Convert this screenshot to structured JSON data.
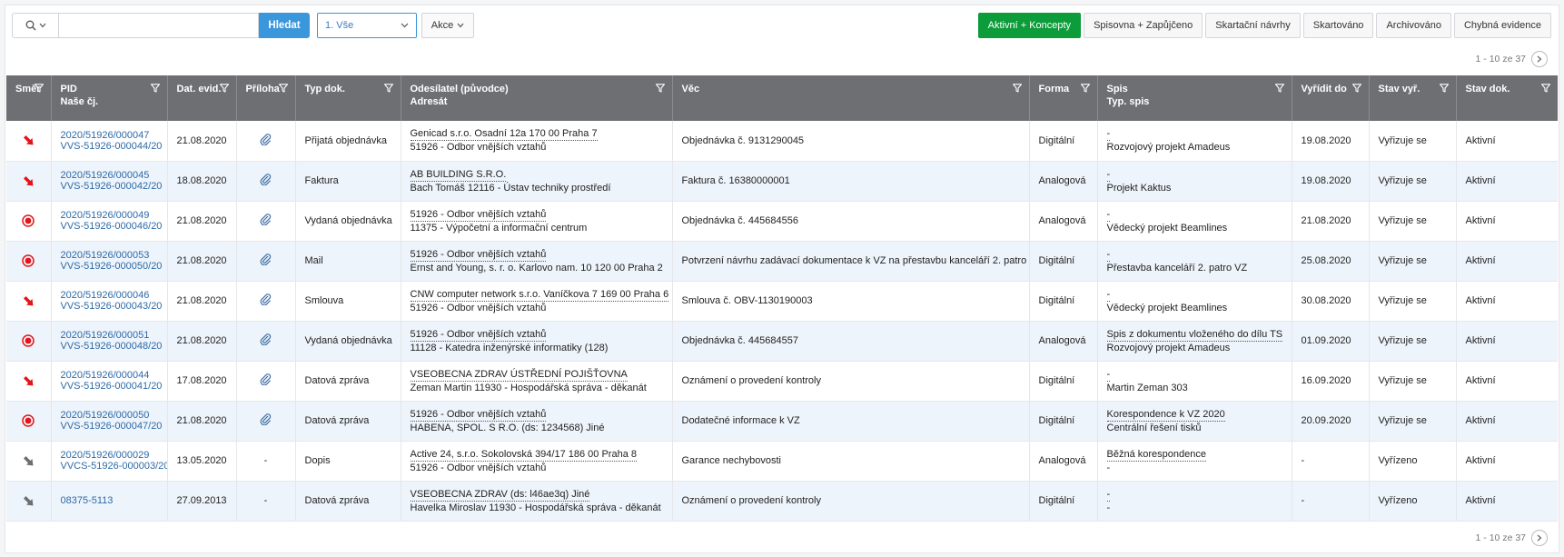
{
  "toolbar": {
    "search_placeholder": "",
    "search_button": "Hledat",
    "filter_select": "1. Vše",
    "actions_button": "Akce",
    "tabs": [
      "Aktivní + Koncepty",
      "Spisovna + Zapůjčeno",
      "Skartační návrhy",
      "Skartováno",
      "Archivováno",
      "Chybná evidence"
    ],
    "active_tab": "Aktivní + Koncepty"
  },
  "pager": {
    "top": "1 - 10 ze 37",
    "bottom": "1 - 10 ze 37"
  },
  "columns": [
    {
      "l1": "Směr",
      "l2": ""
    },
    {
      "l1": "PID",
      "l2": "Naše čj."
    },
    {
      "l1": "Dat. evid.",
      "l2": ""
    },
    {
      "l1": "Příloha",
      "l2": ""
    },
    {
      "l1": "Typ dok.",
      "l2": ""
    },
    {
      "l1": "Odesílatel (původce)",
      "l2": "Adresát"
    },
    {
      "l1": "Věc",
      "l2": ""
    },
    {
      "l1": "Forma",
      "l2": ""
    },
    {
      "l1": "Spis",
      "l2": "Typ. spis"
    },
    {
      "l1": "Vyřídit do",
      "l2": ""
    },
    {
      "l1": "Stav vyř.",
      "l2": ""
    },
    {
      "l1": "Stav dok.",
      "l2": ""
    }
  ],
  "colors": {
    "incoming": "#e3151b",
    "outgoing": "#e3151b",
    "closed": "#6e6e6e",
    "accent": "#3a97dc",
    "active_tab": "#0c9c3a"
  },
  "rows": [
    {
      "dir": "incoming",
      "pid": "2020/51926/000047",
      "cj": "VVS-51926-000044/20",
      "date": "21.08.2020",
      "att": "paperclip",
      "type": "Přijatá objednávka",
      "sender": "Genicad s.r.o. Osadní 12a 170 00 Praha 7",
      "addressee": "51926 - Odbor vnějších vztahů",
      "subject": "Objednávka č. 9131290045",
      "form": "Digitální",
      "file": "-",
      "file_type": "Rozvojový projekt Amadeus",
      "due": "19.08.2020",
      "state": "Vyřizuje se",
      "doc_state": "Aktivní"
    },
    {
      "dir": "incoming",
      "pid": "2020/51926/000045",
      "cj": "VVS-51926-000042/20",
      "date": "18.08.2020",
      "att": "paperclip",
      "type": "Faktura",
      "sender": "AB BUILDING S.R.O.",
      "addressee": "Bach Tomáš 12116 - Ústav techniky prostředí",
      "subject": "Faktura č. 16380000001",
      "form": "Analogová",
      "file": "-",
      "file_type": "Projekt Kaktus",
      "due": "19.08.2020",
      "state": "Vyřizuje se",
      "doc_state": "Aktivní"
    },
    {
      "dir": "outgoing",
      "pid": "2020/51926/000049",
      "cj": "VVS-51926-000046/20",
      "date": "21.08.2020",
      "att": "paperclip",
      "type": "Vydaná objednávka",
      "sender": "51926 - Odbor vnějších vztahů",
      "addressee": "11375 - Výpočetní a informační centrum",
      "subject": "Objednávka č. 445684556",
      "form": "Analogová",
      "file": "-",
      "file_type": "Vědecký projekt Beamlines",
      "due": "21.08.2020",
      "state": "Vyřizuje se",
      "doc_state": "Aktivní"
    },
    {
      "dir": "outgoing",
      "pid": "2020/51926/000053",
      "cj": "VVS-51926-000050/20",
      "date": "21.08.2020",
      "att": "paperclip",
      "type": "Mail",
      "sender": "51926 - Odbor vnějších vztahů",
      "addressee": "Ernst and Young, s. r. o. Karlovo nam. 10 120 00 Praha 2",
      "subject": "Potvrzení návrhu zadávací dokumentace k VZ na přestavbu kanceláří 2. patro",
      "form": "Digitální",
      "file": "-",
      "file_type": "Přestavba kanceláří 2. patro VZ",
      "due": "25.08.2020",
      "state": "Vyřizuje se",
      "doc_state": "Aktivní"
    },
    {
      "dir": "incoming",
      "pid": "2020/51926/000046",
      "cj": "VVS-51926-000043/20",
      "date": "21.08.2020",
      "att": "paperclip",
      "type": "Smlouva",
      "sender": "CNW computer network s.r.o. Vaníčkova 7 169 00 Praha 6",
      "addressee": "51926 - Odbor vnějších vztahů",
      "subject": "Smlouva č. OBV-1130190003",
      "form": "Digitální",
      "file": "-",
      "file_type": "Vědecký projekt Beamlines",
      "due": "30.08.2020",
      "state": "Vyřizuje se",
      "doc_state": "Aktivní"
    },
    {
      "dir": "outgoing",
      "pid": "2020/51926/000051",
      "cj": "VVS-51926-000048/20",
      "date": "21.08.2020",
      "att": "paperclip",
      "type": "Vydaná objednávka",
      "sender": "51926 - Odbor vnějších vztahů",
      "addressee": "11128 - Katedra inženýrské informatiky (128)",
      "subject": "Objednávka č. 445684557",
      "form": "Analogová",
      "file": "Spis z dokumentu vloženého do dílu TS",
      "file_type": "Rozvojový projekt Amadeus",
      "due": "01.09.2020",
      "state": "Vyřizuje se",
      "doc_state": "Aktivní"
    },
    {
      "dir": "incoming",
      "pid": "2020/51926/000044",
      "cj": "VVS-51926-000041/20",
      "date": "17.08.2020",
      "att": "paperclip",
      "type": "Datová zpráva",
      "sender": "VSEOBECNA ZDRAV ÚSTŘEDNÍ POJIŠŤOVNA",
      "addressee": "Zeman Martin 11930 - Hospodářská správa - děkanát",
      "subject": "Oznámení o provedení kontroly",
      "form": "Digitální",
      "file": "-",
      "file_type": "Martin Zeman 303",
      "due": "16.09.2020",
      "state": "Vyřizuje se",
      "doc_state": "Aktivní"
    },
    {
      "dir": "outgoing",
      "pid": "2020/51926/000050",
      "cj": "VVS-51926-000047/20",
      "date": "21.08.2020",
      "att": "paperclip",
      "type": "Datová zpráva",
      "sender": "51926 - Odbor vnějších vztahů",
      "addressee": "HABENA, SPOL. S R.O. (ds: 1234568) Jiné",
      "subject": "Dodatečné informace k VZ",
      "form": "Digitální",
      "file": "Korespondence k VZ 2020",
      "file_type": "Centrální řešení tisků",
      "due": "20.09.2020",
      "state": "Vyřizuje se",
      "doc_state": "Aktivní"
    },
    {
      "dir": "closed",
      "pid": "2020/51926/000029",
      "cj": "VVCS-51926-000003/20",
      "date": "13.05.2020",
      "att": "-",
      "type": "Dopis",
      "sender": "Active 24, s.r.o. Sokolovská 394/17 186 00 Praha 8",
      "addressee": "51926 - Odbor vnějších vztahů",
      "subject": "Garance nechybovosti",
      "form": "Analogová",
      "file": "Běžná korespondence",
      "file_type": "-",
      "due": "-",
      "state": "Vyřízeno",
      "doc_state": "Aktivní"
    },
    {
      "dir": "closed",
      "pid": "08375-5113",
      "cj": "",
      "date": "27.09.2013",
      "att": "-",
      "type": "Datová zpráva",
      "sender": "VSEOBECNA ZDRAV (ds: l46ae3q) Jiné",
      "addressee": "Havelka Miroslav 11930 - Hospodářská správa - děkanát",
      "subject": "Oznámení o provedení kontroly",
      "form": "Digitální",
      "file": "-",
      "file_type": "-",
      "due": "-",
      "state": "Vyřízeno",
      "doc_state": "Aktivní"
    }
  ]
}
